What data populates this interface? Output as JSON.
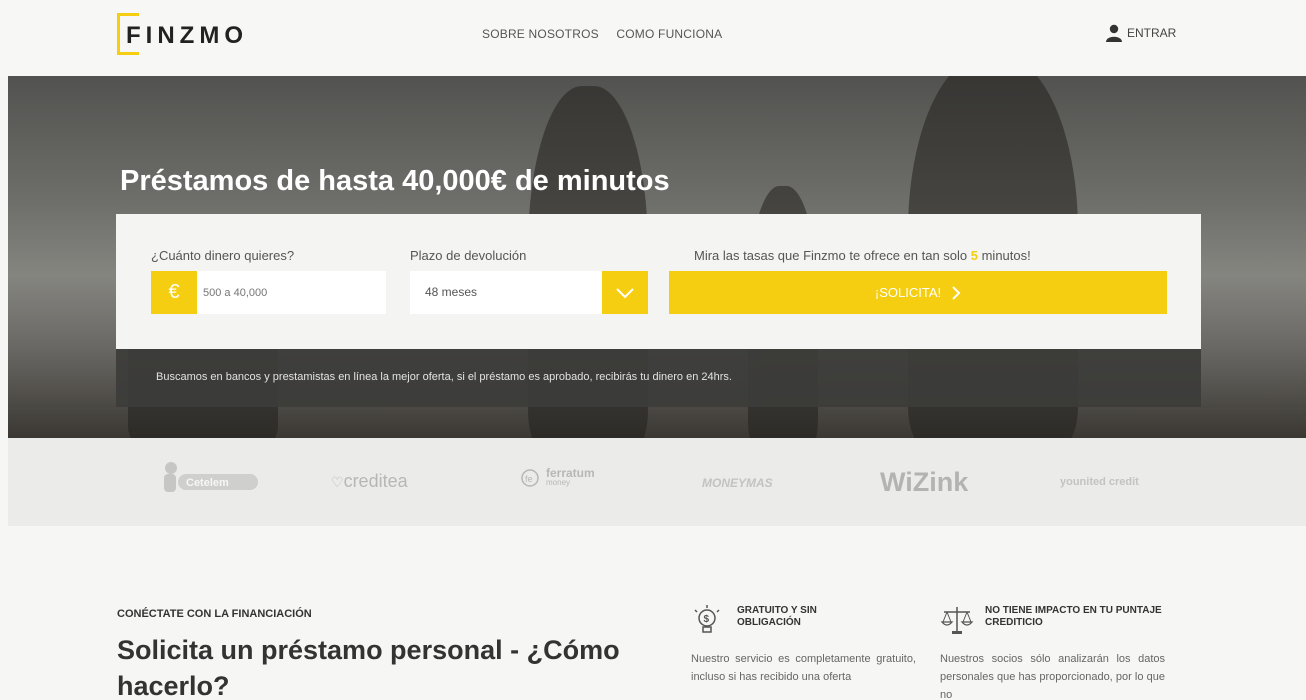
{
  "brand": {
    "name": "FINZMO",
    "accent": "#f6ce11"
  },
  "nav": {
    "about": "SOBRE NOSOTROS",
    "how": "COMO FUNCIONA"
  },
  "login": {
    "label": "ENTRAR",
    "icon": "user-icon"
  },
  "hero": {
    "title": "Préstamos de hasta 40,000€ de minutos",
    "amount_label": "¿Cuánto dinero quieres?",
    "amount_prefix": "€",
    "amount_placeholder": "500 a 40,000",
    "term_label": "Plazo de devolución",
    "term_value": "48 meses",
    "cta_msg_before": "Mira las tasas que Finzmo te ofrece en tan solo ",
    "cta_msg_highlight": "5",
    "cta_msg_after": " minutos!",
    "cta_label": "¡SOLICITA!",
    "info": "Buscamos en bancos y prestamistas en línea la mejor oferta, si el préstamo es aprobado, recibirás tu dinero en 24hrs."
  },
  "partners": {
    "cetelem": "Cetelem",
    "creditea": "creditea",
    "ferratum": "ferratum",
    "ferratum_sub": "money",
    "moneymas": "MONEYMAS",
    "wizink": "WiZink",
    "younited": "younited credit"
  },
  "content": {
    "eyebrow": "CONÉCTATE CON LA FINANCIACIÓN",
    "title": "Solicita un préstamo personal - ¿Cómo hacerlo?",
    "feature1_title": "GRATUITO Y SIN OBLIGACIÓN",
    "feature1_body": "Nuestro servicio es completamente gratuito, incluso si has recibido una oferta",
    "feature2_title": "NO TIENE IMPACTO EN TU PUNTAJE CREDITICIO",
    "feature2_body": "Nuestros socios sólo analizarán los datos personales que has proporcionado, por lo que no"
  }
}
